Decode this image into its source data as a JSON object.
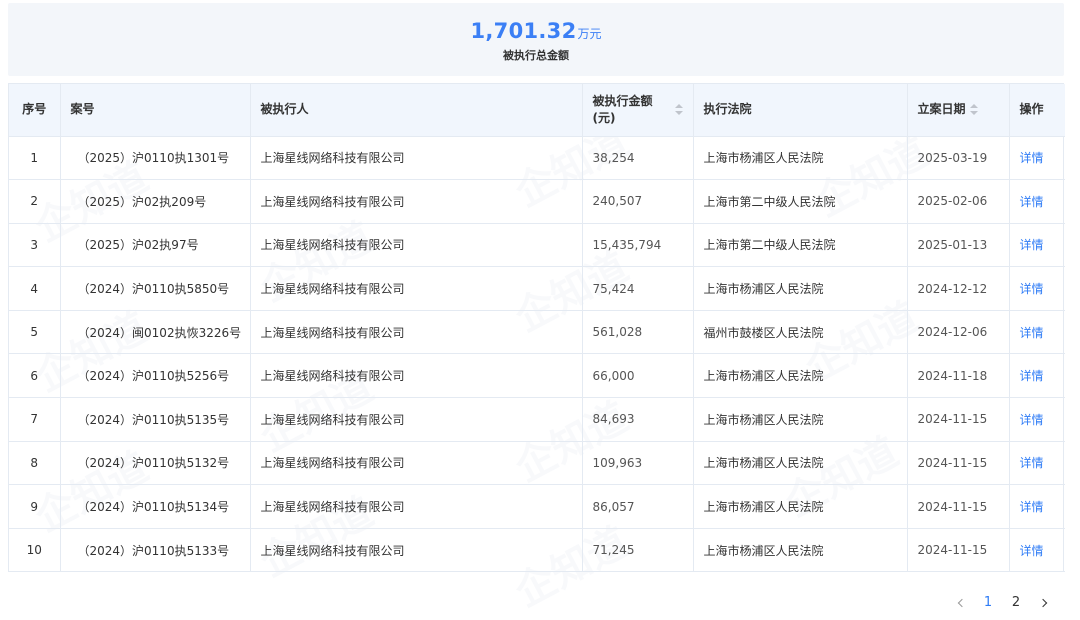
{
  "summary": {
    "amount": "1,701.32",
    "unit": "万元",
    "label": "被执行总金额"
  },
  "watermark_text": "企知道",
  "table": {
    "headers": {
      "index": "序号",
      "case_no": "案号",
      "party": "被执行人",
      "amount": "被执行金额(元)",
      "court": "执行法院",
      "filing_date": "立案日期",
      "action": "操作"
    },
    "rows": [
      {
        "index": "1",
        "case_no": "（2025）沪0110执1301号",
        "party": "上海星线网络科技有限公司",
        "amount": "38,254",
        "court": "上海市杨浦区人民法院",
        "date": "2025-03-19",
        "action": "详情"
      },
      {
        "index": "2",
        "case_no": "（2025）沪02执209号",
        "party": "上海星线网络科技有限公司",
        "amount": "240,507",
        "court": "上海市第二中级人民法院",
        "date": "2025-02-06",
        "action": "详情"
      },
      {
        "index": "3",
        "case_no": "（2025）沪02执97号",
        "party": "上海星线网络科技有限公司",
        "amount": "15,435,794",
        "court": "上海市第二中级人民法院",
        "date": "2025-01-13",
        "action": "详情"
      },
      {
        "index": "4",
        "case_no": "（2024）沪0110执5850号",
        "party": "上海星线网络科技有限公司",
        "amount": "75,424",
        "court": "上海市杨浦区人民法院",
        "date": "2024-12-12",
        "action": "详情"
      },
      {
        "index": "5",
        "case_no": "（2024）闽0102执恢3226号",
        "party": "上海星线网络科技有限公司",
        "amount": "561,028",
        "court": "福州市鼓楼区人民法院",
        "date": "2024-12-06",
        "action": "详情"
      },
      {
        "index": "6",
        "case_no": "（2024）沪0110执5256号",
        "party": "上海星线网络科技有限公司",
        "amount": "66,000",
        "court": "上海市杨浦区人民法院",
        "date": "2024-11-18",
        "action": "详情"
      },
      {
        "index": "7",
        "case_no": "（2024）沪0110执5135号",
        "party": "上海星线网络科技有限公司",
        "amount": "84,693",
        "court": "上海市杨浦区人民法院",
        "date": "2024-11-15",
        "action": "详情"
      },
      {
        "index": "8",
        "case_no": "（2024）沪0110执5132号",
        "party": "上海星线网络科技有限公司",
        "amount": "109,963",
        "court": "上海市杨浦区人民法院",
        "date": "2024-11-15",
        "action": "详情"
      },
      {
        "index": "9",
        "case_no": "（2024）沪0110执5134号",
        "party": "上海星线网络科技有限公司",
        "amount": "86,057",
        "court": "上海市杨浦区人民法院",
        "date": "2024-11-15",
        "action": "详情"
      },
      {
        "index": "10",
        "case_no": "（2024）沪0110执5133号",
        "party": "上海星线网络科技有限公司",
        "amount": "71,245",
        "court": "上海市杨浦区人民法院",
        "date": "2024-11-15",
        "action": "详情"
      }
    ]
  },
  "pagination": {
    "pages": [
      "1",
      "2"
    ],
    "current": "1"
  },
  "colors": {
    "accent": "#2f7cf6",
    "summary_number": "#3b7ff5",
    "header_bg": "#f1f6fd",
    "summary_bg": "#f3f6fa"
  }
}
